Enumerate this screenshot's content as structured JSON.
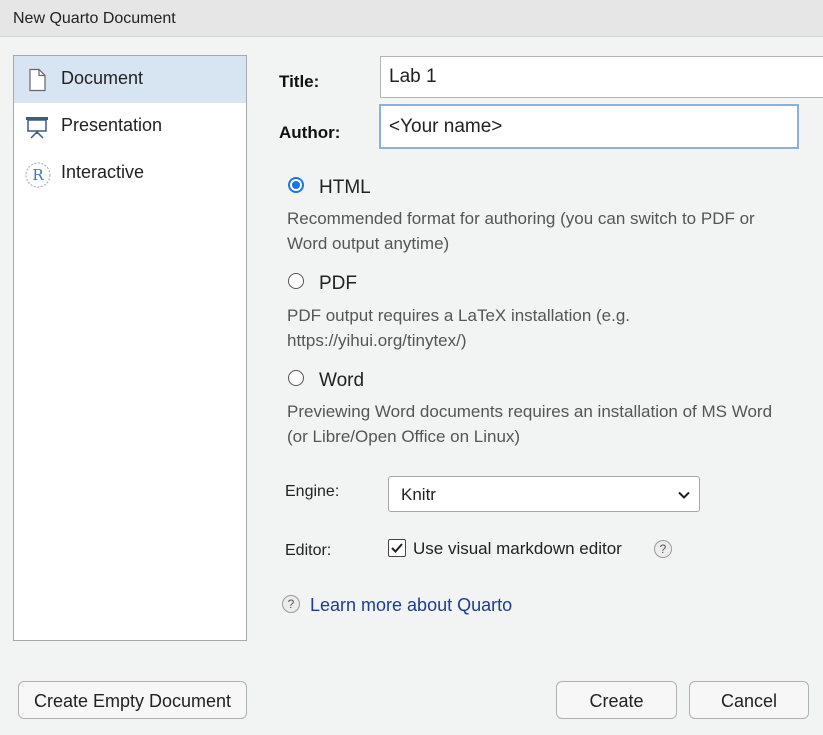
{
  "window": {
    "title": "New Quarto Document"
  },
  "sidebar": {
    "items": [
      {
        "label": "Document",
        "icon": "document-icon",
        "active": true
      },
      {
        "label": "Presentation",
        "icon": "presentation-icon",
        "active": false
      },
      {
        "label": "Interactive",
        "icon": "r-logo-icon",
        "active": false
      }
    ]
  },
  "form": {
    "title_label": "Title:",
    "title_value": "Lab 1",
    "author_label": "Author:",
    "author_value": "<Your name>"
  },
  "formats": [
    {
      "label": "HTML",
      "checked": true,
      "description": "Recommended format for authoring (you can switch to PDF or Word output anytime)"
    },
    {
      "label": "PDF",
      "checked": false,
      "description": "PDF output requires a LaTeX installation (e.g. https://yihui.org/tinytex/)"
    },
    {
      "label": "Word",
      "checked": false,
      "description": "Previewing Word documents requires an installation of MS Word (or Libre/Open Office on Linux)"
    }
  ],
  "engine": {
    "label": "Engine:",
    "value": "Knitr"
  },
  "editor": {
    "label": "Editor:",
    "checkbox_label": "Use visual markdown editor",
    "checked": true
  },
  "help": {
    "glyph": "?",
    "learn_more": "Learn more about Quarto"
  },
  "buttons": {
    "create_empty": "Create Empty Document",
    "create": "Create",
    "cancel": "Cancel"
  },
  "colors": {
    "accent": "#1a73e8",
    "selected_bg": "#d7e4f1",
    "link": "#1c3d8f"
  }
}
